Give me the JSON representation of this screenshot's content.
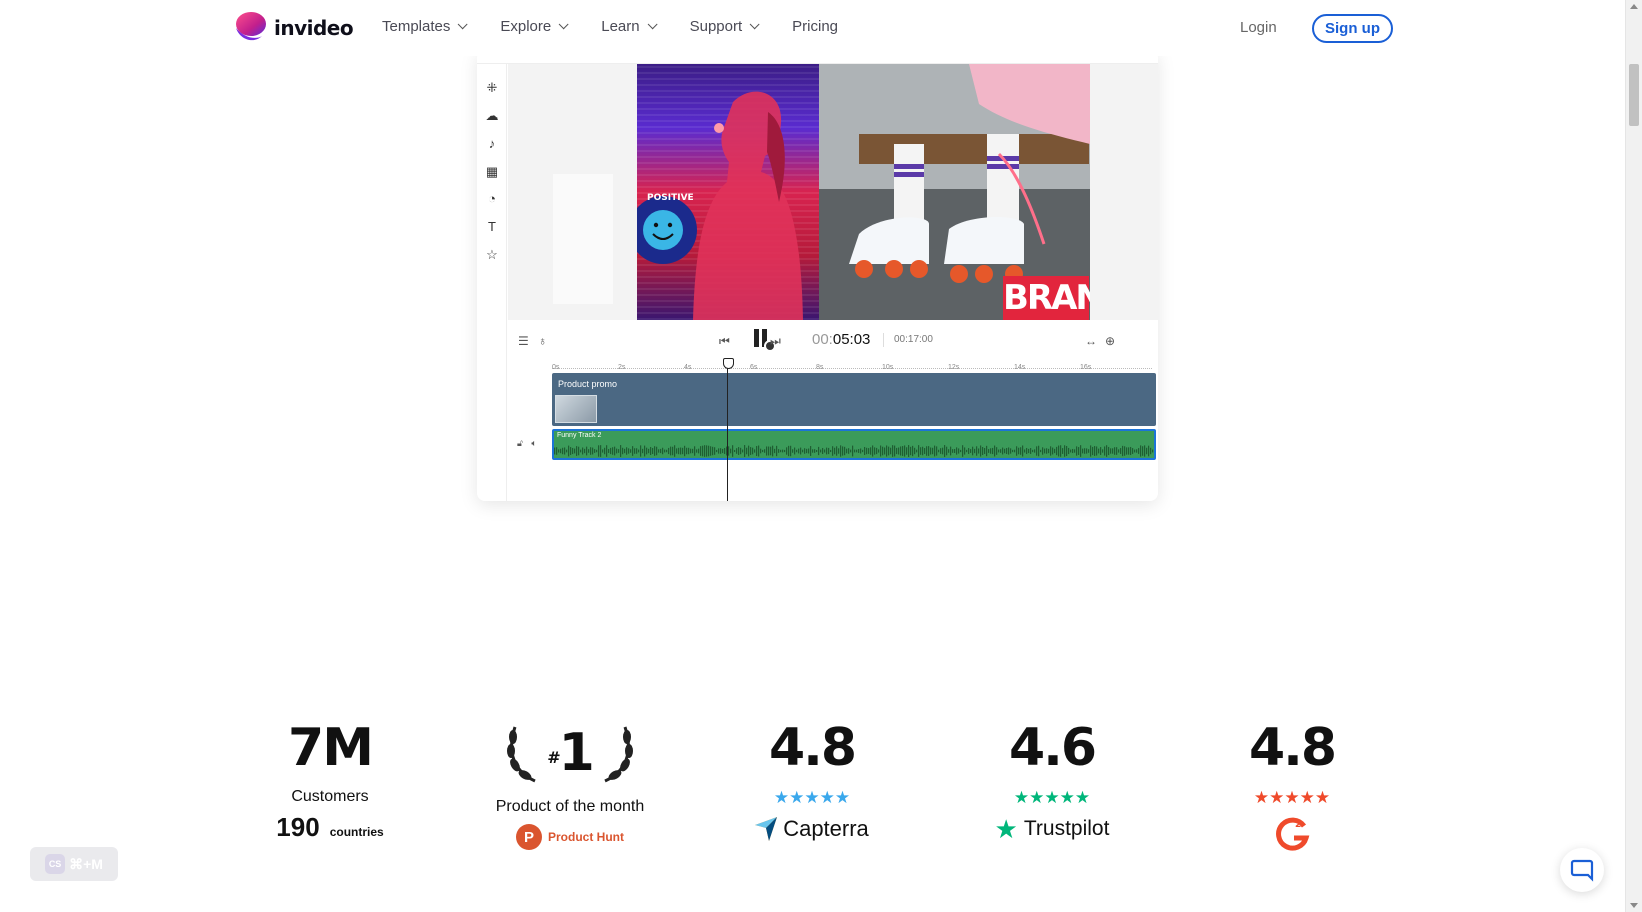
{
  "brand": {
    "name": "invideo"
  },
  "nav": {
    "items": [
      {
        "label": "Templates",
        "dropdown": true
      },
      {
        "label": "Explore",
        "dropdown": true
      },
      {
        "label": "Learn",
        "dropdown": true
      },
      {
        "label": "Support",
        "dropdown": true
      },
      {
        "label": "Pricing",
        "dropdown": false
      }
    ],
    "login": "Login",
    "signup": "Sign up"
  },
  "editor": {
    "canvas": {
      "badge_text": "POSITIVE VIBES",
      "brand_text": "BRAND"
    },
    "controls": {
      "time_prefix": "00:",
      "time_current": "05:03",
      "time_total": "00:17:00"
    },
    "ruler": [
      "0s",
      "2s",
      "4s",
      "6s",
      "8s",
      "10s",
      "12s",
      "14s",
      "16s"
    ],
    "tracks": {
      "video_label": "Product promo",
      "audio_label": "Funny Track 2"
    }
  },
  "stats": [
    {
      "value": "7M",
      "label": "Customers",
      "extra_number": "190",
      "extra_word": "countries"
    },
    {
      "value": "1",
      "prefix": "#",
      "label": "Product of the month",
      "source": "Product Hunt"
    },
    {
      "value": "4.8",
      "stars": "★★★★★",
      "source": "Capterra",
      "color": "#3aa8ec"
    },
    {
      "value": "4.6",
      "stars": "★★★★★",
      "source": "Trustpilot",
      "color": "#00b67a"
    },
    {
      "value": "4.8",
      "stars": "★★★★★",
      "source": "G2",
      "color": "#ef4a2b"
    }
  ],
  "shortcut": {
    "label": "⌘+M",
    "badge": "CS"
  }
}
